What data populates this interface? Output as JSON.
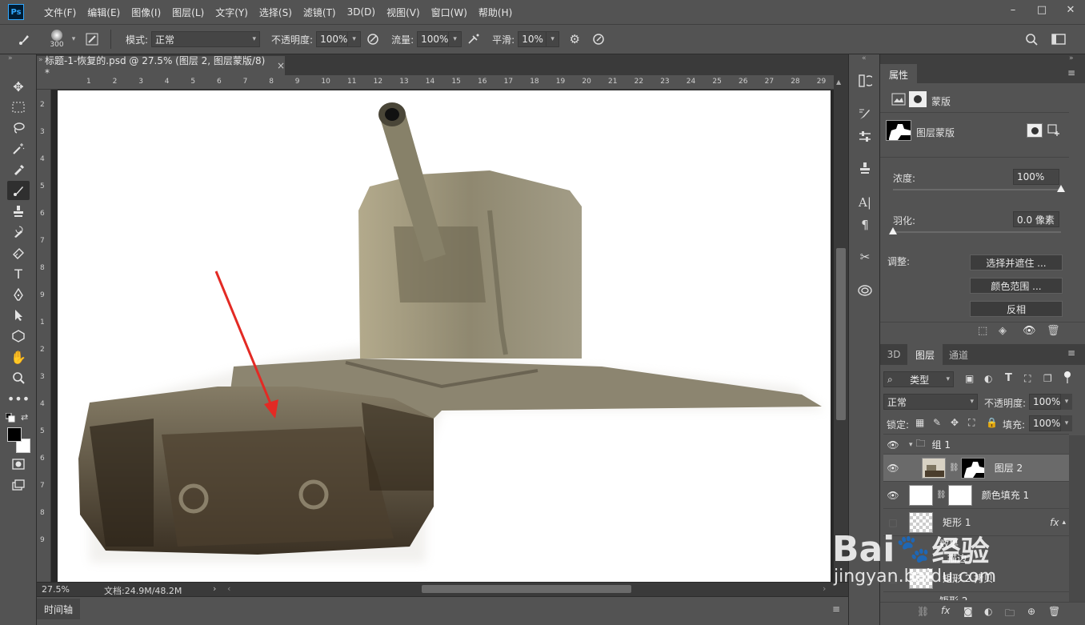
{
  "app": {
    "logo": "Ps"
  },
  "menu": [
    "文件(F)",
    "编辑(E)",
    "图像(I)",
    "图层(L)",
    "文字(Y)",
    "选择(S)",
    "滤镜(T)",
    "3D(D)",
    "视图(V)",
    "窗口(W)",
    "帮助(H)"
  ],
  "window_controls": [
    "–",
    "□",
    "✕"
  ],
  "options": {
    "brush_size": "300",
    "mode_label": "模式:",
    "mode_value": "正常",
    "opacity_label": "不透明度:",
    "opacity_value": "100%",
    "flow_label": "流量:",
    "flow_value": "100%",
    "smooth_label": "平滑:",
    "smooth_value": "10%"
  },
  "document": {
    "tab_title": "标题-1-恢复的.psd @ 27.5% (图层 2, 图层蒙版/8) *",
    "close": "×",
    "zoom": "27.5%",
    "doc_info": "文档:24.9M/48.2M",
    "h_ruler": [
      "1",
      "2",
      "3",
      "4",
      "5",
      "6",
      "7",
      "8",
      "9",
      "10",
      "11",
      "12",
      "13",
      "14",
      "15",
      "16",
      "17",
      "18",
      "19",
      "20",
      "21",
      "22",
      "23",
      "24",
      "25",
      "26",
      "27",
      "28",
      "29"
    ],
    "v_ruler": [
      "2",
      "3",
      "4",
      "5",
      "6",
      "7",
      "8",
      "9",
      "1",
      "2",
      "3",
      "4",
      "5",
      "6",
      "7",
      "8",
      "9"
    ]
  },
  "timeline": {
    "label": "时间轴"
  },
  "properties": {
    "tab": "属性",
    "section_label": "蒙版",
    "mask_label": "图层蒙版",
    "density_label": "浓度:",
    "density_value": "100%",
    "density_level": 1.0,
    "feather_label": "羽化:",
    "feather_value": "0.0 像素",
    "feather_level": 0.0,
    "adjust_label": "调整:",
    "btn_select_mask": "选择并遮住 ...",
    "btn_color_range": "颜色范围 ...",
    "btn_invert": "反相"
  },
  "layers_panel": {
    "tabs": [
      "3D",
      "图层",
      "通道"
    ],
    "filter_label": "类型",
    "blend_mode": "正常",
    "opacity_label": "不透明度:",
    "opacity_value": "100%",
    "lock_label": "锁定:",
    "fill_label": "填充:",
    "fill_value": "100%",
    "layers": [
      {
        "name": "组 1"
      },
      {
        "name": "图层 2"
      },
      {
        "name": "颜色填充 1"
      },
      {
        "name": "矩形 1",
        "fx": "fx"
      },
      {
        "name": "效果"
      },
      {
        "name": "描边"
      },
      {
        "name": "矩形 2 拷贝"
      },
      {
        "name": "矩形 2"
      }
    ]
  },
  "watermark": {
    "brand": "Bai",
    "brand2": "经验",
    "url": "jingyan.baidu.com"
  },
  "colors": {
    "ui_bg": "#535353",
    "panel_dark": "#3a3a3a",
    "selection": "#6a6a6a",
    "arrow": "#e32a24",
    "accent": "#31a8ff"
  }
}
